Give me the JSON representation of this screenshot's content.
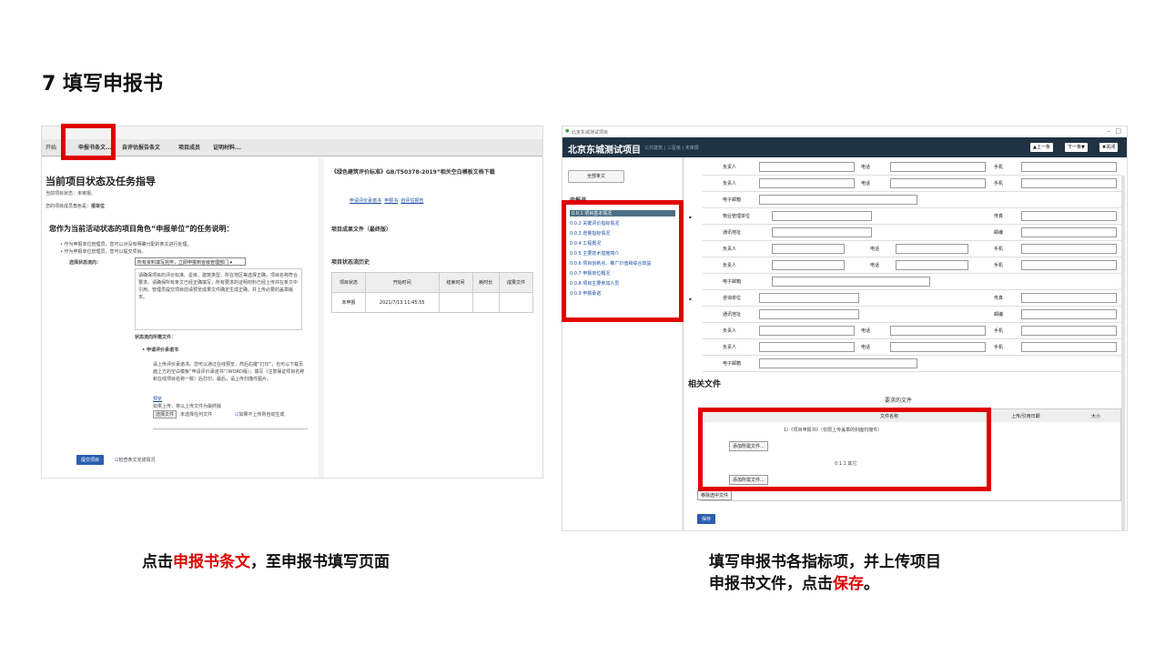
{
  "slide": {
    "title": "7 填写申报书",
    "caption_left": {
      "pre": "点击",
      "highlight": "申报书条文",
      "post": "，至申报书填写页面"
    },
    "caption_right": {
      "pre": "填写申报书各指标项，并上传项目申报书文件，点击",
      "highlight": "保存",
      "post": "。"
    }
  },
  "left": {
    "tabs": [
      "开始",
      "申报书条文...",
      "自评估报告条文",
      "项目成员",
      "证明材料..."
    ],
    "heading": "当前项目状态及任务指导",
    "status_line": "当前项目状态：未审报。",
    "role_line_label": "您的项目成员角色是：",
    "role_value": "报单位",
    "task_heading": "您作为当前活动状态的项目角色“申报单位”的任务说明：",
    "bullets": [
      "作为申报单位管理员，您可以对没有明确分配的条文进行处理。",
      "作为申报单位管理员，您可以提交项目。"
    ],
    "state_label": "选择状态流向：",
    "state_select": "所有资料填写完毕，立即申报到省级管理部门",
    "desc": "请确保项目的评价标准、星级、建筑类型、所在地区等选择正确，项目名称符合要求。请确保所有条文已经正确填写，所有要求的证明材料已经上传并在条文中引用。管理员提交项目前请预览成果文件确定生成正确，并上传必要的盖章版本。",
    "required_label": "状态流向所需文件：",
    "required_item": "申请评价承诺书",
    "upload_desc": "请上传评价承诺书。您可以通过在线预览，然后右键“打印”，也可以下载页面上方的空白模板“申请评价承诺书”（WORD版）；填写（注意保证项目名称和在线项目名称一致）后打印。最后，请上传扫描件图片。",
    "preview_link": "预览",
    "if_upload": "如果上传，将以上传文件为最终版",
    "choose_file": "选择文件",
    "no_file": "未选择任何文件",
    "auto_gen": "如果不上传则自动生成",
    "submit": "提交项目",
    "check_label": "检查条文完成情况",
    "right_title": "《绿色建筑评价标准》GB/T50378-2019”相关空白模板文档下载",
    "right_links": [
      "申请评价承诺书",
      "申报书",
      "自评估报告"
    ],
    "result_title": "项目成果文件（最终版）",
    "history_title": "项目状态流历史",
    "history_headers": [
      "项目状态",
      "开始时间",
      "结束时间",
      "耗时长",
      "成果文件"
    ],
    "history_row": [
      "未申报",
      "2021/7/13 11:45:55",
      "",
      "",
      ""
    ]
  },
  "right": {
    "window_title": "北京东城测试项目",
    "app_title": "北京东城测试项目",
    "nav": "公共建筑 | 三星级 | 未审报",
    "prev": "上一条",
    "next": "下一条",
    "close": "关闭",
    "side_tab": "全部条文",
    "side_section": "申报书",
    "side_items": [
      "0.0.1 项目基本情况",
      "0.0.2 关键评价指标情况",
      "0.0.3 增量指标情况",
      "0.0.4 工程概况",
      "0.0.5 主要技术措施简介",
      "0.0.6 项目创新点、推广价值和综合效益",
      "0.0.7 申报单位概况",
      "0.0.8 项目主要参加人员",
      "0.0.9 申报承诺"
    ],
    "labels": {
      "person": "负责人",
      "phone": "电话",
      "mobile": "手机",
      "email": "电子邮箱",
      "property": "物业管理单位",
      "fax": "传真",
      "address": "通讯地址",
      "zip": "邮编",
      "consult": "咨询单位"
    },
    "files_title": "相关文件",
    "required_files": "要求的文件",
    "col_name": "文件名称",
    "col_date": "上传/引用日期",
    "col_size": "大小",
    "file1": "1）《项目申报书》（仅限上传盖章的封面扫描件）",
    "add_btn": "添加所需文件...",
    "file2": "0.1.1 其它",
    "remove_btn": "移除选中文件",
    "save": "保存"
  }
}
